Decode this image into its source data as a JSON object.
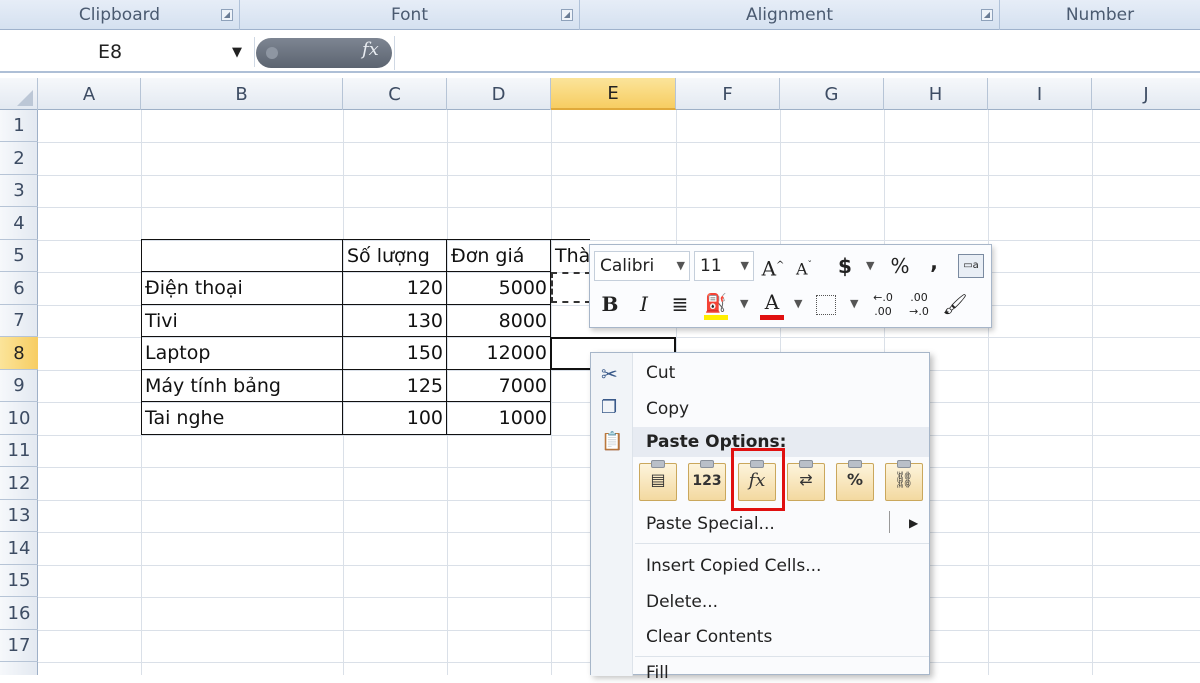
{
  "ribbon": {
    "groups": [
      "Clipboard",
      "Font",
      "Alignment",
      "Number"
    ]
  },
  "formula_bar": {
    "name_box": "E8",
    "fx_label": "fx",
    "value": ""
  },
  "columns": [
    "A",
    "B",
    "C",
    "D",
    "E",
    "F",
    "G",
    "H",
    "I",
    "J"
  ],
  "selected_column": "E",
  "rows": [
    "1",
    "2",
    "3",
    "4",
    "5",
    "6",
    "7",
    "8",
    "9",
    "10",
    "11",
    "12",
    "13",
    "14",
    "15",
    "16",
    "17"
  ],
  "selected_row": "8",
  "table": {
    "headers": {
      "b": "",
      "c": "Số lượng",
      "d": "Đơn giá",
      "e": "Thà"
    },
    "rows": [
      {
        "name": "Điện thoại",
        "qty": "120",
        "price": "5000"
      },
      {
        "name": "Tivi",
        "qty": "130",
        "price": "8000"
      },
      {
        "name": "Laptop",
        "qty": "150",
        "price": "12000"
      },
      {
        "name": "Máy tính bảng",
        "qty": "125",
        "price": "7000"
      },
      {
        "name": "Tai nghe",
        "qty": "100",
        "price": "1000"
      }
    ]
  },
  "mini_toolbar": {
    "font": "Calibri",
    "size": "11",
    "grow": "A",
    "shrink": "A",
    "currency": "$",
    "percent": "%",
    "comma": ",",
    "bold": "B",
    "italic": "I",
    "font_color": "A",
    "inc_decimal": ".00",
    "dec_decimal": ".0"
  },
  "context_menu": {
    "cut": "Cut",
    "copy": "Copy",
    "paste_options": "Paste Options:",
    "paste_icons": [
      "paste-icon",
      "values-123-icon",
      "formulas-fx-icon",
      "transpose-icon",
      "formatting-percent-icon",
      "paste-link-icon"
    ],
    "paste_values_label": "123",
    "paste_formulas_label": "fx",
    "paste_formatting_label": "%",
    "paste_special": "Paste Special...",
    "insert_copied": "Insert Copied Cells...",
    "delete": "Delete...",
    "clear_contents": "Clear Contents",
    "fill": "Fill"
  },
  "colors": {
    "selection_header": "#f7cd62",
    "highlight_border": "#e01010",
    "font_color_bar": "#e01010",
    "fill_color_bar": "#ffee00"
  }
}
